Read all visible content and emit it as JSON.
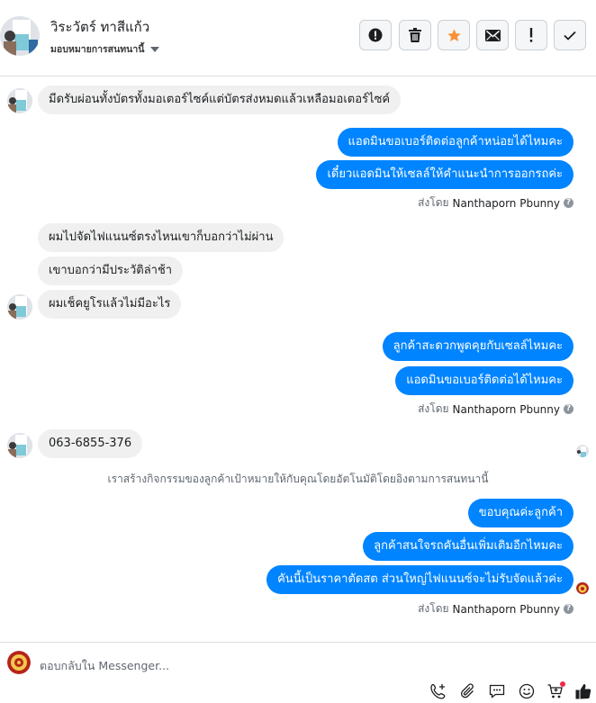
{
  "header": {
    "contact_name": "วิระวัตร์ ทาสีแก้ว",
    "assign_label": "มอบหมายการสนทนานี้",
    "buttons": [
      {
        "name": "spam-button",
        "icon": "alert-circle-icon"
      },
      {
        "name": "delete-button",
        "icon": "trash-icon"
      },
      {
        "name": "star-button",
        "icon": "star-icon",
        "color": "#f7923b"
      },
      {
        "name": "mark-unread-button",
        "icon": "envelope-icon"
      },
      {
        "name": "follow-up-button",
        "icon": "exclamation-icon"
      },
      {
        "name": "done-button",
        "icon": "check-icon"
      }
    ]
  },
  "conversation": {
    "messages": [
      {
        "id": 1,
        "dir": "in",
        "text": "มีดรับผ่อนทั้งบัตรทั้งมอเตอร์ไซค์แต่บัตรส่งหมดแล้วเหลือมอเตอร์ไซค์"
      },
      {
        "id": 2,
        "dir": "out",
        "text": "แอดมินขอเบอร์ติดต่อลูกค้าหน่อยได้ไหมคะ"
      },
      {
        "id": 3,
        "dir": "out",
        "text": "เดี๋ยวแอดมินให้เซลล์ให้คำแนะนำการออกรถค่ะ"
      },
      {
        "id": 4,
        "dir": "in",
        "text": "ผมไปจัดไฟแนนซ์ตรงไหนเขาก็บอกว่าไม่ผ่าน"
      },
      {
        "id": 5,
        "dir": "in",
        "text": "เขาบอกว่ามีประวัติล่าช้า"
      },
      {
        "id": 6,
        "dir": "in",
        "text": "ผมเช็คยูโรแล้วไม่มีอะไร"
      },
      {
        "id": 7,
        "dir": "out",
        "text": "ลูกค้าสะดวกพูดคุยกับเซลล์ไหมคะ"
      },
      {
        "id": 8,
        "dir": "out",
        "text": "แอดมินขอเบอร์ติดต่อได้ไหมคะ"
      },
      {
        "id": 9,
        "dir": "in",
        "text": "063-6855-376"
      },
      {
        "id": 10,
        "dir": "out",
        "text": "ขอบคุณค่ะลูกค้า"
      },
      {
        "id": 11,
        "dir": "out",
        "text": "ลูกค้าสนใจรถคันอื่นเพิ่มเติมอีกไหมคะ"
      },
      {
        "id": 12,
        "dir": "out",
        "text": "คันนี้เป็นราคาตัดสต ส่วนใหญ่ไฟแนนซ์จะไม่รับจัดแล้วค่ะ"
      }
    ],
    "sent_by_prefix": "ส่งโดย",
    "sent_by_name": "Nanthaporn Pbunny",
    "system_notice": "เราสร้างกิจกรรมของลูกค้าเป้าหมายให้กับคุณโดยอัตโนมัติโดยอิงตามการสนทนานี้"
  },
  "composer": {
    "placeholder": "ตอบกลับใน Messenger...",
    "tools": [
      {
        "name": "add-call-icon"
      },
      {
        "name": "attach-icon"
      },
      {
        "name": "saved-replies-icon"
      },
      {
        "name": "emoji-icon"
      },
      {
        "name": "cart-icon"
      },
      {
        "name": "like-icon"
      }
    ]
  },
  "colors": {
    "outgoing_bubble": "#0084ff",
    "incoming_bubble": "#f0f0f0",
    "notification_dot": "#f02849"
  }
}
